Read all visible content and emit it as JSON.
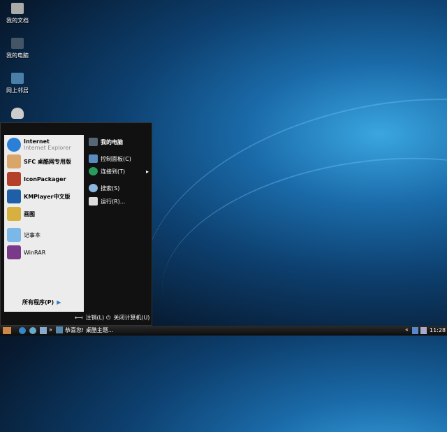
{
  "desktop": {
    "icons": [
      {
        "label": "我的文档"
      },
      {
        "label": "我的电脑"
      },
      {
        "label": "网上邻居"
      },
      {
        "label": "回收站"
      }
    ]
  },
  "start_menu": {
    "pinned": [
      {
        "title": "Internet",
        "subtitle": "Internet Explorer"
      },
      {
        "title": "SFC 桌酷网专用版"
      },
      {
        "title": "IconPackager"
      },
      {
        "title": "KMPlayer中文版"
      },
      {
        "title": "画图"
      },
      {
        "title": "记事本"
      },
      {
        "title": "WinRAR"
      }
    ],
    "all_programs": "所有程序(P)",
    "right": [
      {
        "label": "我的电脑"
      },
      {
        "label": "控制面板(C)"
      },
      {
        "label": "连接到(T)"
      },
      {
        "label": "搜索(S)"
      },
      {
        "label": "运行(R)..."
      }
    ],
    "logoff": "注销(L)",
    "shutdown": "关闭计算机(U)"
  },
  "taskbar": {
    "task": "恭喜您! 桌酷主题...",
    "clock": "11:28",
    "overflow": "»"
  }
}
